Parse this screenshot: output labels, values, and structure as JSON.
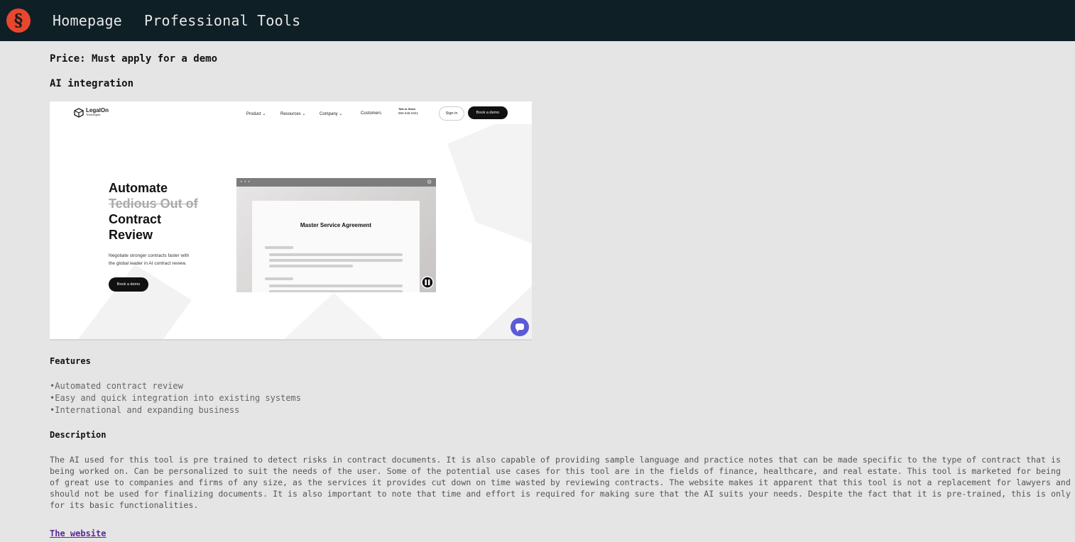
{
  "topbar": {
    "logo_glyph": "§",
    "links": [
      "Homepage",
      "Professional Tools"
    ]
  },
  "price": "Price: Must apply for a demo",
  "ai_heading": "AI integration",
  "screenshot": {
    "brand": "LegalOn",
    "brand_sub": "Technologies",
    "nav": [
      "Product ⌄",
      "Resources ⌄",
      "Company ⌄",
      "Customers"
    ],
    "sales_label": "Talk to Sales",
    "sales_phone": "984-646-0341",
    "sign_in": "Sign in",
    "book_demo": "Book a demo",
    "hero": [
      "Automate",
      "Tedious Out of",
      "Contract",
      "Review"
    ],
    "hero_sub_1": "Negotiate stronger contracts faster with",
    "hero_sub_2": "the global leader in AI contract review.",
    "hero_button": "Book a demo",
    "doc_title": "Master Service Agreement"
  },
  "features": {
    "heading": "Features",
    "items": [
      "•Automated contract review",
      "•Easy and quick integration into existing systems",
      "•International and expanding business"
    ]
  },
  "description": {
    "heading": "Description",
    "text": "The AI used for this tool is pre trained to detect risks in contract documents. It is also capable of providing sample language and practice notes that can be made specific to the type of contract that is being worked on. Can be personalized to suit the needs of the user. Some of the potential use cases for this tool are in the fields of finance, healthcare, and real estate. This tool is marketed for being of great use to companies and firms of any size, as the services it provides cut down on time wasted by reviewing contracts. The website makes it apparent that this tool is not a replacement for lawyers and should not be used for finalizing documents. It is also important to note that time and effort is required for making sure that the AI suits your needs. Despite the fact that it is pre-trained, this is only for its basic functionalities."
  },
  "website_link": "The website",
  "colors": {
    "topbar_bg": "#0f1f26",
    "logo_accent": "#e8472f",
    "page_bg": "#e5e5e5",
    "link": "#5b2a9a",
    "chat_bubble": "#5d5bd4"
  }
}
